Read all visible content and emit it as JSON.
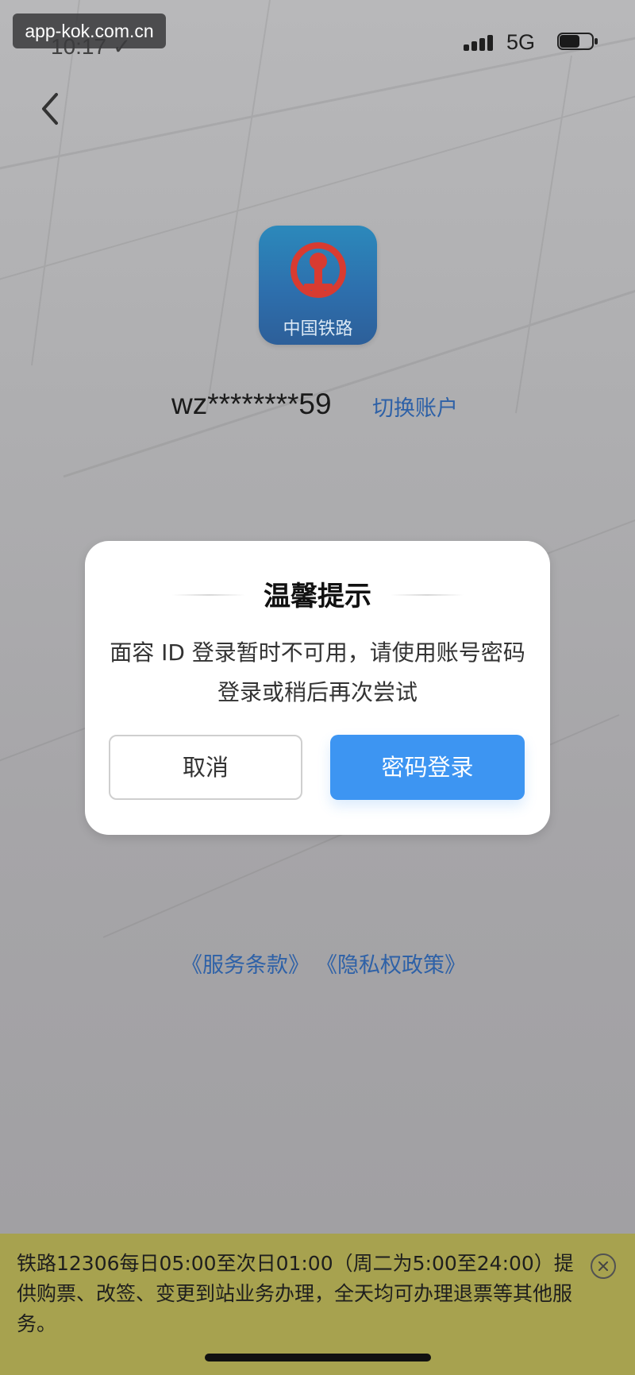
{
  "status_bar": {
    "watermark": "app-kok.com.cn",
    "time_ghost": "10:17 ✓",
    "network": "5G"
  },
  "login": {
    "logo_text": "中国铁路",
    "account_masked": "wz********59",
    "switch_account": "切换账户"
  },
  "dialog": {
    "title": "温馨提示",
    "message": "面容 ID 登录暂时不可用，请使用账号密码登录或稍后再次尝试",
    "cancel": "取消",
    "confirm": "密码登录"
  },
  "links": {
    "terms": "《服务条款》",
    "privacy": "《隐私权政策》"
  },
  "notice": {
    "text": "铁路12306每日05:00至次日01:00（周二为5:00至24:00）提供购票、改签、变更到站业务办理，全天均可办理退票等其他服务。"
  },
  "icons": {
    "back": "chevron-left-icon",
    "signal": "signal-icon",
    "battery": "battery-icon",
    "emblem": "railway-emblem-icon",
    "close": "close-icon"
  },
  "colors": {
    "link": "#2e61a7",
    "primary_button": "#3d95f2",
    "notice_background": "#a7a24f",
    "logo_red": "#d83b31"
  }
}
